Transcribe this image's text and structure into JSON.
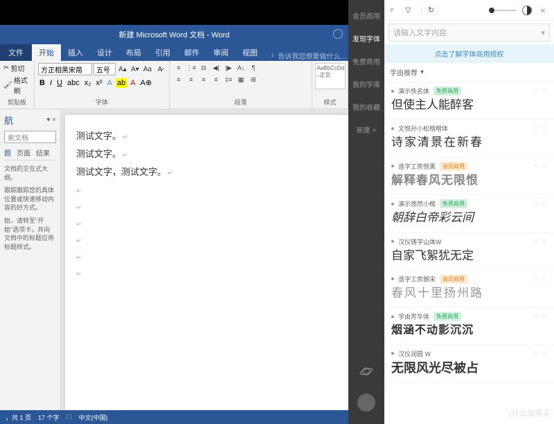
{
  "word": {
    "title": "新建 Microsoft Word 文档 - Word",
    "tellme": "告诉我您想要做什么...",
    "tabs": {
      "file": "文件",
      "home": "开始",
      "insert": "插入",
      "design": "设计",
      "layout": "布局",
      "references": "引用",
      "mailings": "邮件",
      "review": "审阅",
      "view": "视图"
    },
    "ribbon": {
      "clipboard": {
        "cut": "剪切",
        "formatPainter": "格式刷",
        "label": "剪贴板"
      },
      "font": {
        "name": "方正相黑宋简",
        "size": "五号",
        "label": "字体"
      },
      "paragraph": {
        "label": "段落"
      },
      "styles": {
        "preview": "AaBbCcDd",
        "normal": "↓正文",
        "label": "样式"
      }
    },
    "nav": {
      "title": "航",
      "search": "索文档",
      "tabs": {
        "headings": "题",
        "pages": "页面",
        "results": "结果"
      },
      "text1": "文档的交互式大纲。",
      "text2": "跟踪跟踪您的具体位置或快速移动内容的好方式。",
      "text3": "始，请转至\"开始\"选项卡，并向文档中的标题应用标题样式。"
    },
    "document": {
      "line1": "测试文字。",
      "line2": "测试文字。",
      "line3": "测试文字，测试文字。"
    },
    "status": {
      "page": "，共 1 页",
      "words": "17 个字",
      "lang": "中文(中国)"
    }
  },
  "sidebar": {
    "items": [
      "会员商用",
      "发现字体",
      "免费商用",
      "我的字库",
      "我的收藏",
      "新建 +"
    ]
  },
  "fontPanel": {
    "searchPlaceholder": "请输入文字内容",
    "banner": "点击了解字体商用授权",
    "filterLabel": "字由推荐",
    "fonts": [
      {
        "name": "演示佚名体",
        "badge": "免费商用",
        "badgeType": "free",
        "preview": "但使主人能醉客",
        "cls": "f1"
      },
      {
        "name": "文悦孙小松楷楷体",
        "badge": "",
        "badgeType": "",
        "preview": "诗家清景在新春",
        "cls": "f2"
      },
      {
        "name": "造字工房悦黑",
        "badge": "会员商用",
        "badgeType": "paid",
        "preview": "解释春风无限恨",
        "cls": "f3"
      },
      {
        "name": "演示悠然小楷",
        "badge": "免费商用",
        "badgeType": "free",
        "preview": "朝辞白帝彩云间",
        "cls": "f4"
      },
      {
        "name": "汉仪铸字山体W",
        "badge": "",
        "badgeType": "",
        "preview": "自家飞絮犹无定",
        "cls": "f5"
      },
      {
        "name": "造字工房朗宋",
        "badge": "会员商用",
        "badgeType": "paid",
        "preview": "春风十里扬州路",
        "cls": "f6"
      },
      {
        "name": "字由芳华体",
        "badge": "免费商用",
        "badgeType": "free",
        "preview": "烟涵不动影沉沉",
        "cls": "f7"
      },
      {
        "name": "汉仪润圆 W",
        "badge": "",
        "badgeType": "",
        "preview": "无限风光尽被占",
        "cls": "f8"
      }
    ]
  },
  "watermark": "(什么值得买"
}
